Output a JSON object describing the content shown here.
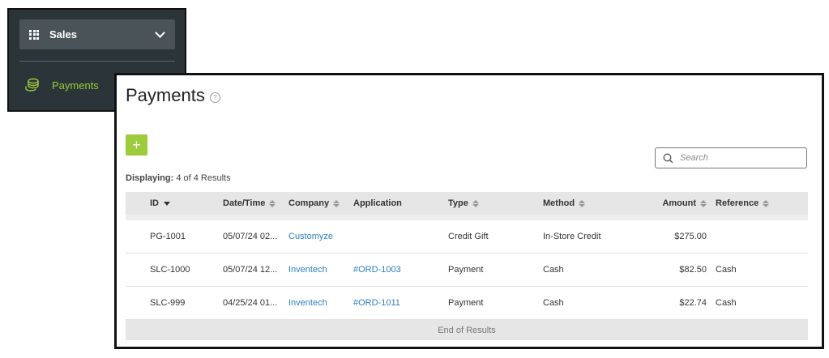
{
  "nav": {
    "section_label": "Sales",
    "section_icon": "grid-icon",
    "item_label": "Payments",
    "item_icon": "coins-icon",
    "accent": "#9ccb3b"
  },
  "page": {
    "title": "Payments",
    "help_icon": "?",
    "add_label": "+",
    "search_placeholder": "Search",
    "displaying_label": "Displaying:",
    "displaying_text": "4 of 4 Results",
    "end_text": "End of Results"
  },
  "table": {
    "headers": {
      "id": "ID",
      "date": "Date/Time",
      "company": "Company",
      "application": "Application",
      "type": "Type",
      "method": "Method",
      "amount": "Amount",
      "reference": "Reference"
    },
    "rows": [
      {
        "id": "PG-1001",
        "date": "05/07/24 02...",
        "company": "Customyze",
        "application": "",
        "type": "Credit Gift",
        "method": "In-Store Credit",
        "amount": "$275.00",
        "reference": ""
      },
      {
        "id": "SLC-1000",
        "date": "05/07/24 12...",
        "company": "Inventech",
        "application": "#ORD-1003",
        "type": "Payment",
        "method": "Cash",
        "amount": "$82.50",
        "reference": "Cash"
      },
      {
        "id": "SLC-999",
        "date": "04/25/24 01...",
        "company": "Inventech",
        "application": "#ORD-1011",
        "type": "Payment",
        "method": "Cash",
        "amount": "$22.74",
        "reference": "Cash"
      }
    ]
  }
}
